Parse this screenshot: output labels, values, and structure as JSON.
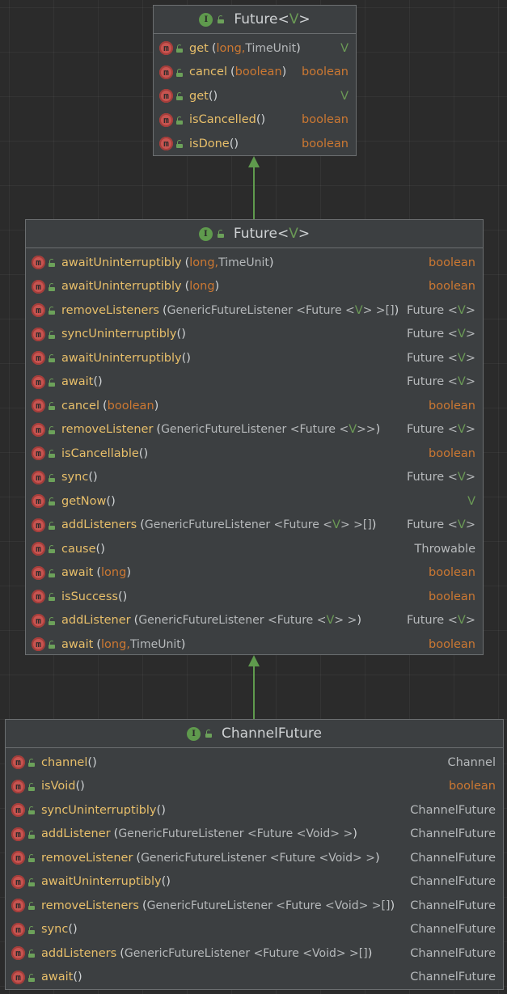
{
  "colors": {
    "background": "#2b2b2b",
    "box_fill": "#3c3f41",
    "box_border": "#6b6e70",
    "method_name": "#e8bf6a",
    "primitive": "#cc7832",
    "type_param": "#6a9955",
    "reference_type": "#b6b9bb",
    "arrow": "#5f9a4d",
    "method_icon": "#c75450"
  },
  "icons": {
    "interface": "interface-i-badge-icon",
    "method": "method-m-icon",
    "public": "public-lock-icon"
  },
  "boxes": [
    {
      "id": "future-java",
      "badge": "I",
      "title": "Future",
      "title_param": "V",
      "methods": [
        {
          "name": "get",
          "params": [
            {
              "text": "long,",
              "kind": "prim"
            },
            {
              "text": "TimeUnit",
              "kind": "ref"
            }
          ],
          "ret": "V",
          "ret_kind": "tparam"
        },
        {
          "name": "cancel",
          "params": [
            {
              "text": "boolean",
              "kind": "prim"
            }
          ],
          "ret": "boolean",
          "ret_kind": "prim"
        },
        {
          "name": "get",
          "params": [],
          "ret": "V",
          "ret_kind": "tparam"
        },
        {
          "name": "isCancelled",
          "params": [],
          "ret": "boolean",
          "ret_kind": "prim"
        },
        {
          "name": "isDone",
          "params": [],
          "ret": "boolean",
          "ret_kind": "prim"
        }
      ]
    },
    {
      "id": "future-netty",
      "badge": "I",
      "title": "Future",
      "title_param": "V",
      "methods": [
        {
          "name": "awaitUninterruptibly",
          "params": [
            {
              "text": "long,",
              "kind": "prim"
            },
            {
              "text": "TimeUnit",
              "kind": "ref"
            }
          ],
          "ret": "boolean",
          "ret_kind": "prim"
        },
        {
          "name": "awaitUninterruptibly",
          "params": [
            {
              "text": "long",
              "kind": "prim"
            }
          ],
          "ret": "boolean",
          "ret_kind": "prim"
        },
        {
          "name": "removeListeners",
          "params": [
            {
              "text": "GenericFutureListener <Future <",
              "kind": "ref"
            },
            {
              "text": "V",
              "kind": "tparam"
            },
            {
              "text": "> >[]",
              "kind": "ref"
            }
          ],
          "ret": "Future <V>",
          "ret_kind": "ref-generic"
        },
        {
          "name": "syncUninterruptibly",
          "params": [],
          "ret": "Future <V>",
          "ret_kind": "ref-generic"
        },
        {
          "name": "awaitUninterruptibly",
          "params": [],
          "ret": "Future <V>",
          "ret_kind": "ref-generic"
        },
        {
          "name": "await",
          "params": [],
          "ret": "Future <V>",
          "ret_kind": "ref-generic"
        },
        {
          "name": "cancel",
          "params": [
            {
              "text": "boolean",
              "kind": "prim"
            }
          ],
          "ret": "boolean",
          "ret_kind": "prim"
        },
        {
          "name": "removeListener",
          "params": [
            {
              "text": "GenericFutureListener <Future <",
              "kind": "ref"
            },
            {
              "text": "V",
              "kind": "tparam"
            },
            {
              "text": ">>",
              "kind": "ref"
            }
          ],
          "ret": "Future <V>",
          "ret_kind": "ref-generic"
        },
        {
          "name": "isCancellable",
          "params": [],
          "ret": "boolean",
          "ret_kind": "prim"
        },
        {
          "name": "sync",
          "params": [],
          "ret": "Future <V>",
          "ret_kind": "ref-generic"
        },
        {
          "name": "getNow",
          "params": [],
          "ret": "V",
          "ret_kind": "tparam"
        },
        {
          "name": "addListeners",
          "params": [
            {
              "text": "GenericFutureListener <Future <",
              "kind": "ref"
            },
            {
              "text": "V",
              "kind": "tparam"
            },
            {
              "text": "> >[]",
              "kind": "ref"
            }
          ],
          "ret": "Future <V>",
          "ret_kind": "ref-generic"
        },
        {
          "name": "cause",
          "params": [],
          "ret": "Throwable",
          "ret_kind": "ref"
        },
        {
          "name": "await",
          "params": [
            {
              "text": "long",
              "kind": "prim"
            }
          ],
          "ret": "boolean",
          "ret_kind": "prim"
        },
        {
          "name": "isSuccess",
          "params": [],
          "ret": "boolean",
          "ret_kind": "prim"
        },
        {
          "name": "addListener",
          "params": [
            {
              "text": "GenericFutureListener <Future <",
              "kind": "ref"
            },
            {
              "text": "V",
              "kind": "tparam"
            },
            {
              "text": "> >",
              "kind": "ref"
            }
          ],
          "ret": "Future <V>",
          "ret_kind": "ref-generic"
        },
        {
          "name": "await",
          "params": [
            {
              "text": "long,",
              "kind": "prim"
            },
            {
              "text": "TimeUnit",
              "kind": "ref"
            }
          ],
          "ret": "boolean",
          "ret_kind": "prim"
        }
      ]
    },
    {
      "id": "channel-future",
      "badge": "I",
      "title": "ChannelFuture",
      "title_param": "",
      "methods": [
        {
          "name": "channel",
          "params": [],
          "ret": "Channel",
          "ret_kind": "ref"
        },
        {
          "name": "isVoid",
          "params": [],
          "ret": "boolean",
          "ret_kind": "prim"
        },
        {
          "name": "syncUninterruptibly",
          "params": [],
          "ret": "ChannelFuture",
          "ret_kind": "ref"
        },
        {
          "name": "addListener",
          "params": [
            {
              "text": "GenericFutureListener <Future <Void> >",
              "kind": "ref"
            }
          ],
          "ret": "ChannelFuture",
          "ret_kind": "ref"
        },
        {
          "name": "removeListener",
          "params": [
            {
              "text": "GenericFutureListener <Future <Void> >",
              "kind": "ref"
            }
          ],
          "ret": "ChannelFuture",
          "ret_kind": "ref"
        },
        {
          "name": "awaitUninterruptibly",
          "params": [],
          "ret": "ChannelFuture",
          "ret_kind": "ref"
        },
        {
          "name": "removeListeners",
          "params": [
            {
              "text": "GenericFutureListener <Future <Void> >[]",
              "kind": "ref"
            }
          ],
          "ret": "ChannelFuture",
          "ret_kind": "ref"
        },
        {
          "name": "sync",
          "params": [],
          "ret": "ChannelFuture",
          "ret_kind": "ref"
        },
        {
          "name": "addListeners",
          "params": [
            {
              "text": "GenericFutureListener <Future <Void> >[]",
              "kind": "ref"
            }
          ],
          "ret": "ChannelFuture",
          "ret_kind": "ref"
        },
        {
          "name": "await",
          "params": [],
          "ret": "ChannelFuture",
          "ret_kind": "ref"
        }
      ]
    }
  ],
  "relations": [
    {
      "from": "future-netty",
      "to": "future-java",
      "kind": "extends"
    },
    {
      "from": "channel-future",
      "to": "future-netty",
      "kind": "extends"
    }
  ]
}
